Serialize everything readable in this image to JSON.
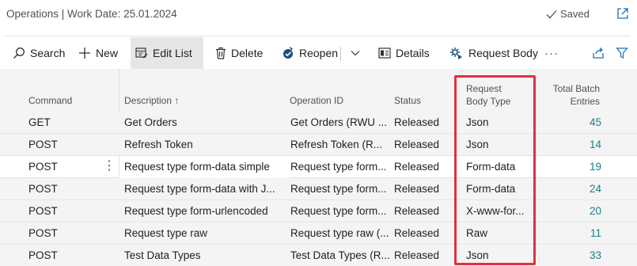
{
  "window": {
    "title": "Operations | Work Date: 25.01.2024",
    "saved_label": "Saved"
  },
  "toolbar": {
    "search_label": "Search",
    "new_label": "New",
    "edit_list_label": "Edit List",
    "delete_label": "Delete",
    "reopen_label": "Reopen",
    "details_label": "Details",
    "request_body_label": "Request Body",
    "more_label": "···"
  },
  "columns": {
    "command": "Command",
    "description": "Description ↑",
    "operation_id": "Operation ID",
    "status": "Status",
    "request_body_type_line1": "Request",
    "request_body_type_line2": "Body Type",
    "total_batch_line1": "Total Batch",
    "total_batch_line2": "Entries"
  },
  "rows": [
    {
      "command": "GET",
      "description": "Get Orders",
      "operation_id": "Get Orders (RWU ...",
      "status": "Released",
      "body_type": "Json",
      "total": "45"
    },
    {
      "command": "POST",
      "description": "Refresh Token",
      "operation_id": "Refresh Token (R...",
      "status": "Released",
      "body_type": "Json",
      "total": "14"
    },
    {
      "command": "POST",
      "description": "Request type form-data simple",
      "operation_id": "Request type form...",
      "status": "Released",
      "body_type": "Form-data",
      "total": "19"
    },
    {
      "command": "POST",
      "description": "Request type form-data with J...",
      "operation_id": "Request type form...",
      "status": "Released",
      "body_type": "Form-data",
      "total": "24"
    },
    {
      "command": "POST",
      "description": "Request type form-urlencoded",
      "operation_id": "Request type form...",
      "status": "Released",
      "body_type": "X-www-for...",
      "total": "20"
    },
    {
      "command": "POST",
      "description": "Request type raw",
      "operation_id": "Request type raw (...",
      "status": "Released",
      "body_type": "Raw",
      "total": "11"
    },
    {
      "command": "POST",
      "description": "Test Data Types",
      "operation_id": "Test Data Types (R...",
      "status": "Released",
      "body_type": "Json",
      "total": "33"
    }
  ],
  "colors": {
    "accent_number": "#1a7d8c",
    "highlight_border": "#e0313d",
    "toolbar_active": "#e6e6e6",
    "grid_background": "#f4f4f4"
  },
  "icons": [
    "check-icon",
    "popout-icon",
    "search-icon",
    "plus-icon",
    "edit-list-icon",
    "trash-icon",
    "reopen-icon",
    "chevron-down-icon",
    "details-icon",
    "request-body-icon",
    "share-icon",
    "filter-icon",
    "kebab-icon"
  ]
}
